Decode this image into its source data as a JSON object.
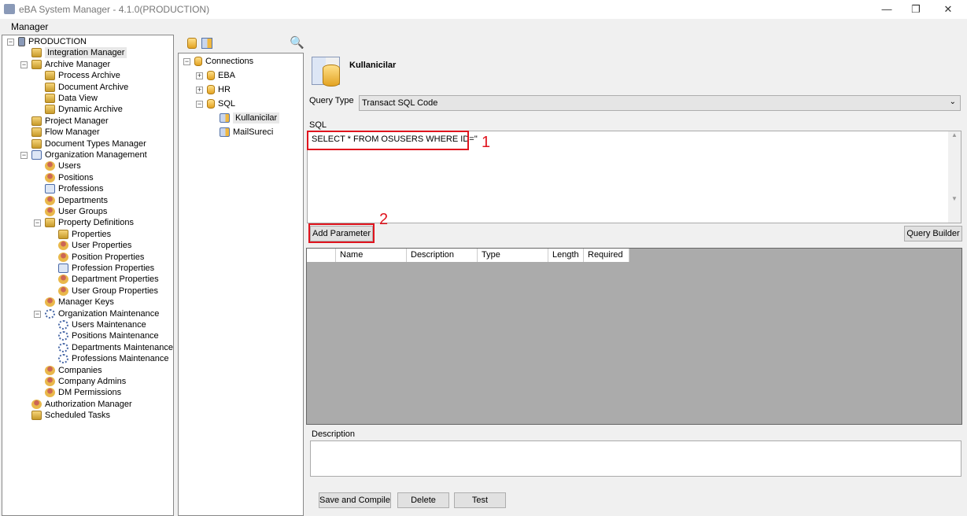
{
  "window": {
    "title": "eBA System Manager - 4.1.0(PRODUCTION)",
    "minimize": "—",
    "restore": "❐",
    "close": "✕"
  },
  "menu": {
    "manager": "Manager"
  },
  "left_tree": [
    {
      "label": "PRODUCTION",
      "level": 0,
      "icon": "server",
      "exp": "−"
    },
    {
      "label": "Integration Manager",
      "level": 1,
      "icon": "folder",
      "selected": true
    },
    {
      "label": "Archive Manager",
      "level": 1,
      "icon": "folder",
      "exp": "−"
    },
    {
      "label": "Process Archive",
      "level": 2,
      "icon": "folder"
    },
    {
      "label": "Document Archive",
      "level": 2,
      "icon": "folder"
    },
    {
      "label": "Data View",
      "level": 2,
      "icon": "folder"
    },
    {
      "label": "Dynamic Archive",
      "level": 2,
      "icon": "folder"
    },
    {
      "label": "Project Manager",
      "level": 1,
      "icon": "folder"
    },
    {
      "label": "Flow Manager",
      "level": 1,
      "icon": "folder"
    },
    {
      "label": "Document Types Manager",
      "level": 1,
      "icon": "folder"
    },
    {
      "label": "Organization Management",
      "level": 1,
      "icon": "card",
      "exp": "−"
    },
    {
      "label": "Users",
      "level": 2,
      "icon": "user"
    },
    {
      "label": "Positions",
      "level": 2,
      "icon": "user"
    },
    {
      "label": "Professions",
      "level": 2,
      "icon": "card"
    },
    {
      "label": "Departments",
      "level": 2,
      "icon": "user"
    },
    {
      "label": "User Groups",
      "level": 2,
      "icon": "user"
    },
    {
      "label": "Property Definitions",
      "level": 2,
      "icon": "folder",
      "exp": "−"
    },
    {
      "label": "Properties",
      "level": 3,
      "icon": "folder"
    },
    {
      "label": "User Properties",
      "level": 3,
      "icon": "user"
    },
    {
      "label": "Position Properties",
      "level": 3,
      "icon": "user"
    },
    {
      "label": "Profession Properties",
      "level": 3,
      "icon": "card"
    },
    {
      "label": "Department Properties",
      "level": 3,
      "icon": "user"
    },
    {
      "label": "User Group Properties",
      "level": 3,
      "icon": "user"
    },
    {
      "label": "Manager Keys",
      "level": 2,
      "icon": "user"
    },
    {
      "label": "Organization Maintenance",
      "level": 2,
      "icon": "gear",
      "exp": "−"
    },
    {
      "label": "Users Maintenance",
      "level": 3,
      "icon": "gear"
    },
    {
      "label": "Positions Maintenance",
      "level": 3,
      "icon": "gear"
    },
    {
      "label": "Departments Maintenance",
      "level": 3,
      "icon": "gear"
    },
    {
      "label": "Professions Maintenance",
      "level": 3,
      "icon": "gear"
    },
    {
      "label": "Companies",
      "level": 2,
      "icon": "user"
    },
    {
      "label": "Company Admins",
      "level": 2,
      "icon": "user"
    },
    {
      "label": "DM Permissions",
      "level": 2,
      "icon": "user"
    },
    {
      "label": "Authorization Manager",
      "level": 1,
      "icon": "user"
    },
    {
      "label": "Scheduled Tasks",
      "level": 1,
      "icon": "folder"
    }
  ],
  "conn_tree": [
    {
      "label": "Connections",
      "level": 0,
      "icon": "db",
      "exp": "−"
    },
    {
      "label": "EBA",
      "level": 1,
      "icon": "db",
      "exp": "+"
    },
    {
      "label": "HR",
      "level": 1,
      "icon": "db",
      "exp": "+"
    },
    {
      "label": "SQL",
      "level": 1,
      "icon": "db",
      "exp": "−"
    },
    {
      "label": "Kullanicilar",
      "level": 2,
      "icon": "table",
      "selected": true
    },
    {
      "label": "MailSureci",
      "level": 2,
      "icon": "table"
    }
  ],
  "detail": {
    "name": "Kullanicilar",
    "query_type_label": "Query Type",
    "query_type_value": "Transact SQL Code",
    "sql_label": "SQL",
    "sql_value": "SELECT * FROM OSUSERS WHERE ID=''",
    "annotation_1": "1",
    "annotation_2": "2",
    "add_parameter": "Add Parameter",
    "query_builder": "Query Builder",
    "columns": [
      "Name",
      "Description",
      "Type",
      "Length",
      "Required"
    ],
    "description_label": "Description",
    "description_value": "",
    "save_compile": "Save and Compile",
    "delete": "Delete",
    "test": "Test"
  }
}
